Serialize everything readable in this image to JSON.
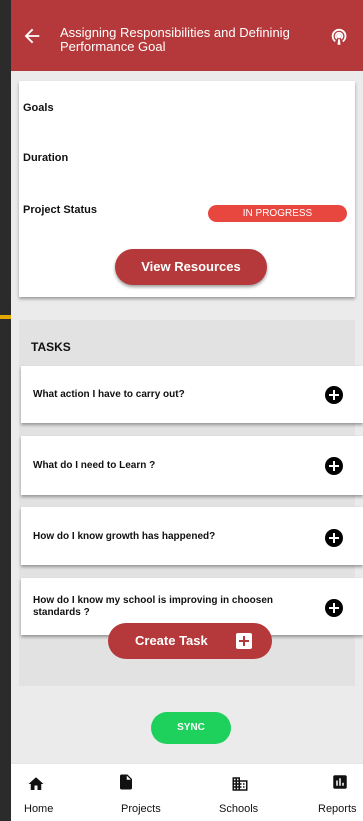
{
  "header": {
    "title": "Assigning Responsibilities and Defininig Performance Goal",
    "back_icon": "arrow-left-icon",
    "right_icon": "podcast-icon"
  },
  "info": {
    "goals_label": "Goals",
    "duration_label": "Duration",
    "status_label": "Project Status",
    "status_value": "IN PROGRESS",
    "view_resources": "View Resources"
  },
  "tasks": {
    "heading": "TASKS",
    "items": [
      {
        "label": "What action I have to carry out?"
      },
      {
        "label": "What do I need to Learn ?"
      },
      {
        "label": "How do I know growth has happened?"
      },
      {
        "label": "How do I know my school is improving in choosen standards ?"
      }
    ],
    "create_label": "Create Task",
    "sync_label": "SYNC"
  },
  "nav": {
    "items": [
      {
        "label": "Home",
        "icon": "home-icon"
      },
      {
        "label": "Projects",
        "icon": "file-icon"
      },
      {
        "label": "Schools",
        "icon": "building-icon"
      },
      {
        "label": "Reports",
        "icon": "bar-chart-icon"
      }
    ]
  },
  "colors": {
    "primary": "#b5393a",
    "status": "#e8473f",
    "sync": "#1ed05c"
  }
}
